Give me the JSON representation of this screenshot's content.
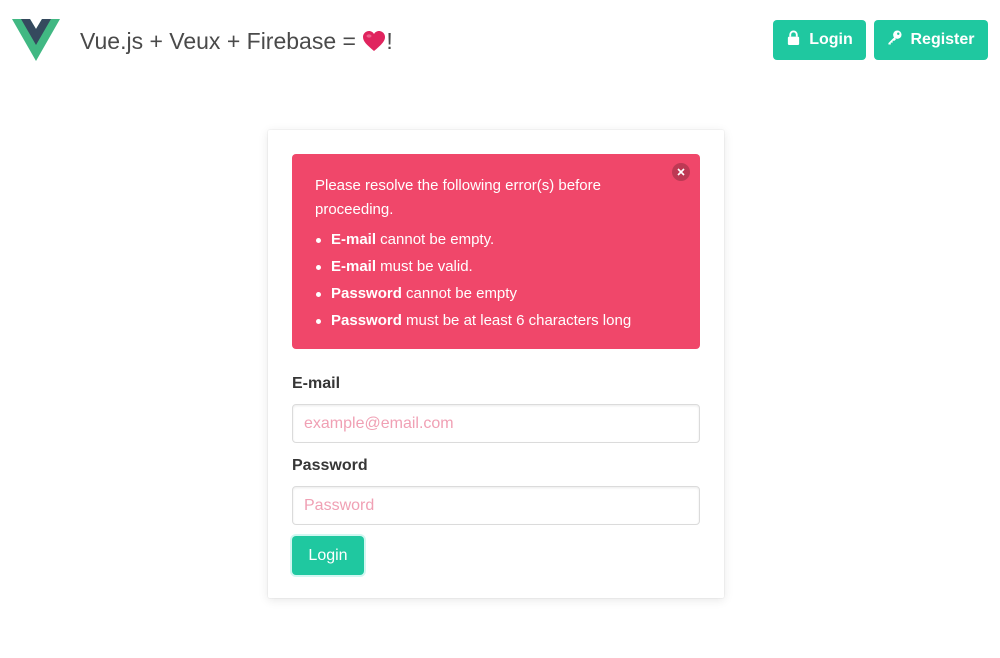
{
  "colors": {
    "accent": "#1fc8a0",
    "danger": "#f0476a",
    "text": "#363636",
    "vue_green": "#41b883",
    "vue_dark": "#35495e",
    "heart": "#e0245e"
  },
  "navbar": {
    "logo_icon": "vue-logo-icon",
    "title": "Vue.js + Veux + Firebase = ",
    "title_suffix": "!",
    "heart_icon": "heart-icon",
    "login_button": {
      "icon": "lock-icon",
      "label": "Login"
    },
    "register_button": {
      "icon": "key-icon",
      "label": "Register"
    }
  },
  "notification": {
    "close_icon": "close-icon",
    "message": "Please resolve the following error(s) before proceeding.",
    "errors": [
      {
        "field": "E-mail",
        "text": " cannot be empty."
      },
      {
        "field": "E-mail",
        "text": " must be valid."
      },
      {
        "field": "Password",
        "text": " cannot be empty"
      },
      {
        "field": "Password",
        "text": " must be at least 6 characters long"
      }
    ]
  },
  "form": {
    "email": {
      "label": "E-mail",
      "placeholder": "example@email.com",
      "value": ""
    },
    "password": {
      "label": "Password",
      "placeholder": "Password",
      "value": ""
    },
    "submit_label": "Login"
  }
}
